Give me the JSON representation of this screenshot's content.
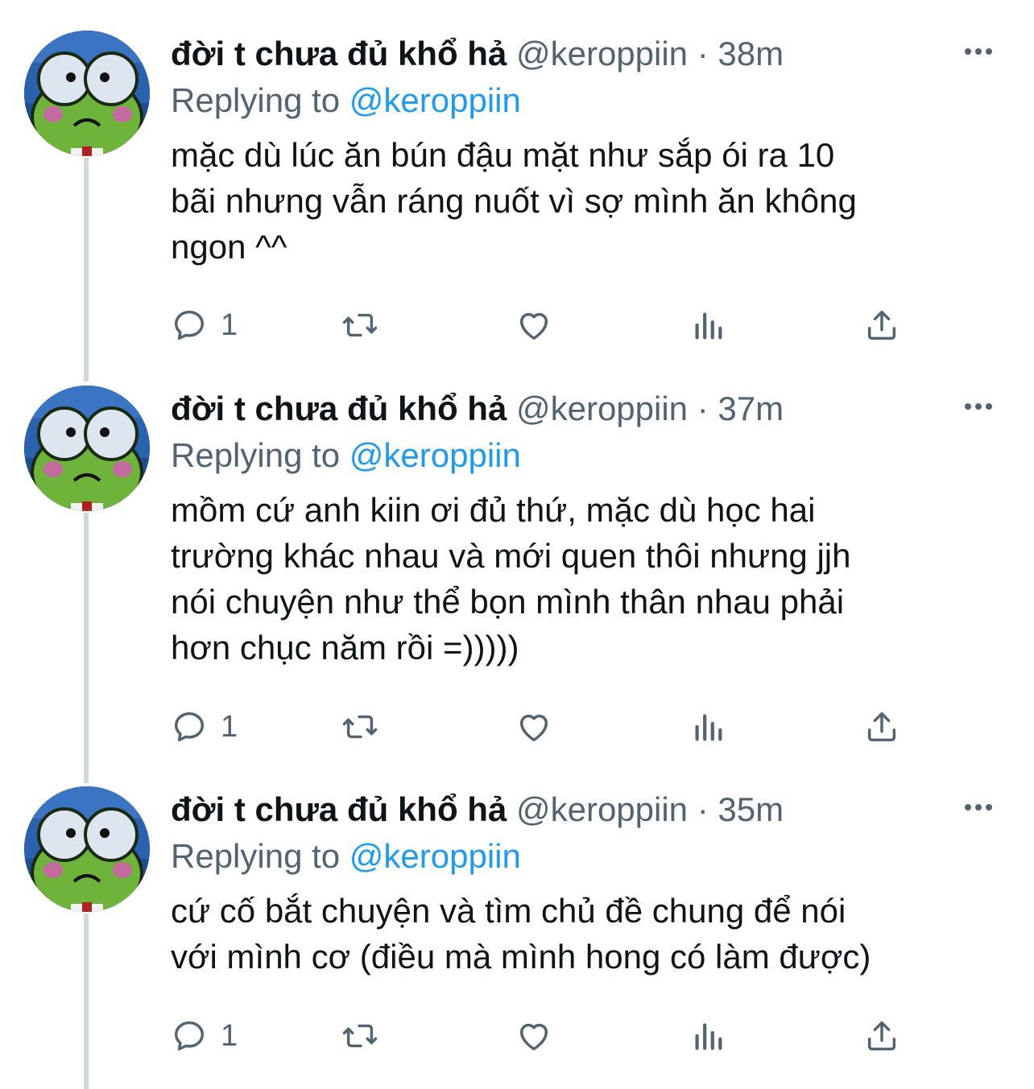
{
  "tweets": [
    {
      "name": "đời t chưa đủ khổ hả",
      "handle": "@keroppiin",
      "time": "38m",
      "replying_prefix": "Replying to",
      "replying_handle": "@keroppiin",
      "text": "mặc dù lúc ăn bún đậu mặt như sắp ói ra 10\nbãi nhưng vẫn ráng nuốt vì sợ mình ăn không\nngon ^^",
      "reply_count": "1"
    },
    {
      "name": "đời t chưa đủ khổ hả",
      "handle": "@keroppiin",
      "time": "37m",
      "replying_prefix": "Replying to",
      "replying_handle": "@keroppiin",
      "text": "mồm cứ anh kiin ơi đủ thứ, mặc dù học hai\ntrường khác nhau và mới quen thôi nhưng jjh\nnói chuyện như thể bọn mình thân nhau phải\nhơn chục năm rồi =)))))",
      "reply_count": "1"
    },
    {
      "name": "đời t chưa đủ khổ hả",
      "handle": "@keroppiin",
      "time": "35m",
      "replying_prefix": "Replying to",
      "replying_handle": "@keroppiin",
      "text": "cứ cố bắt chuyện và tìm chủ đề chung để nói\nvới mình cơ (điều mà mình hong có làm được)",
      "reply_count": "1"
    }
  ],
  "colors": {
    "text": "#0f1419",
    "muted": "#536471",
    "link": "#1d9bf0",
    "thread_line": "#cfd9de"
  },
  "icons": [
    "reply-icon",
    "retweet-icon",
    "like-icon",
    "views-icon",
    "share-icon",
    "more-icon"
  ]
}
